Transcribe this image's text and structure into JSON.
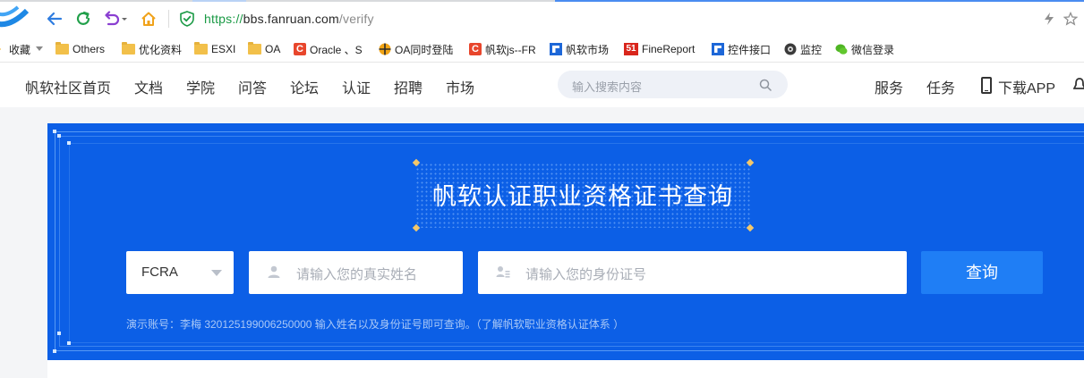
{
  "browser": {
    "url_scheme": "https://",
    "url_host": "bbs.fanruan.com",
    "url_path": "/verify"
  },
  "bookmarks": [
    {
      "label": "收藏",
      "icon": "star-icon"
    },
    {
      "label": "Others",
      "icon": "folder-icon"
    },
    {
      "label": "优化资料",
      "icon": "folder-icon"
    },
    {
      "label": "ESXI",
      "icon": "folder-icon"
    },
    {
      "label": "OA",
      "icon": "folder-icon"
    },
    {
      "label": "Oracle 、S",
      "icon": "csdn-icon"
    },
    {
      "label": "OA同时登陆",
      "icon": "globe-icon"
    },
    {
      "label": "帆软js--FR",
      "icon": "csdn-icon"
    },
    {
      "label": "帆软市场",
      "icon": "fanruan-icon"
    },
    {
      "label": "FineReport",
      "icon": "51-icon"
    },
    {
      "label": "控件接口",
      "icon": "fanruan-icon"
    },
    {
      "label": "监控",
      "icon": "camera-icon"
    },
    {
      "label": "微信登录",
      "icon": "wechat-icon"
    }
  ],
  "nav": {
    "items": [
      "帆软社区首页",
      "文档",
      "学院",
      "问答",
      "论坛",
      "认证",
      "招聘",
      "市场"
    ],
    "search_placeholder": "输入搜索内容",
    "service": "服务",
    "tasks": "任务",
    "download_app": "下载APP"
  },
  "banner": {
    "title": "帆软认证职业资格证书查询",
    "cert_select": "FCRA",
    "name_placeholder": "请输入您的真实姓名",
    "id_placeholder": "请输入您的身份证号",
    "query_button": "查询",
    "hint": "演示账号：李梅 320125199006250000 输入姓名以及身份证号即可查询。（了解帆软职业资格认证体系 ）"
  },
  "colors": {
    "banner_bg": "#0c5fe6",
    "query_button": "#1f7ef5",
    "accent_diamond": "#f4c76a"
  }
}
